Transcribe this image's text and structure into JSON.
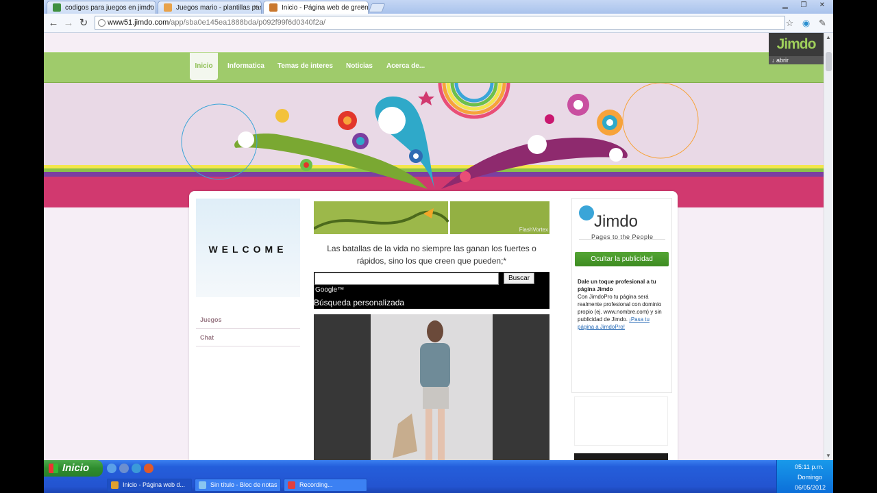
{
  "browser": {
    "tabs": [
      {
        "title": "codigos para juegos en jimdo",
        "favicon_color": "#3f8f3f"
      },
      {
        "title": "Juegos mario - plantillas para",
        "favicon_color": "#e8a24a"
      },
      {
        "title": "Inicio - Página web de greenar",
        "favicon_color": "#c9782e"
      }
    ],
    "url_host": "www51.jimdo.com",
    "url_path": "/app/sba0e145ea1888bda/p092f99f6d0340f2a/"
  },
  "site": {
    "nav": [
      "Inicio",
      "Informatica",
      "Temas de interes",
      "Noticias",
      "Acerca de..."
    ],
    "jimdo_badge": {
      "logo": "Jimdo",
      "open_label": "abrir"
    },
    "welcome_text": "WELCOME",
    "sidebar_links": [
      "Juegos",
      "Chat"
    ],
    "flash_caption": "FlashVortex",
    "quote": "Las batallas de la vida no siempre las ganan los fuertes o rápidos, sino los que creen que pueden;*",
    "search": {
      "button": "Buscar",
      "brand": "Google™",
      "caption": "Búsqueda personalizada"
    },
    "right": {
      "logo": "Jimdo",
      "tagline": "Pages to the People",
      "hide_ads_button": "Ocultar la publicidad",
      "promo_title": "Dale un toque profesional a tu página Jimdo",
      "promo_body": "Con JimdoPro tu página será realmente profesional con dominio propio (ej. www.nombre.com) y sin publicidad de Jimdo.",
      "promo_link": "¡Pasa tu página a JimdoPro!"
    }
  },
  "taskbar": {
    "start": "Inicio",
    "items": [
      {
        "label": "Inicio - Página web d...",
        "icon_color": "#e0a030"
      },
      {
        "label": "Sin título - Bloc de notas",
        "icon_color": "#8ac6f0"
      },
      {
        "label": "Recording...",
        "icon_color": "#e04040"
      }
    ],
    "time": "05:11 p.m.",
    "day": "Domingo",
    "date": "06/05/2012"
  }
}
